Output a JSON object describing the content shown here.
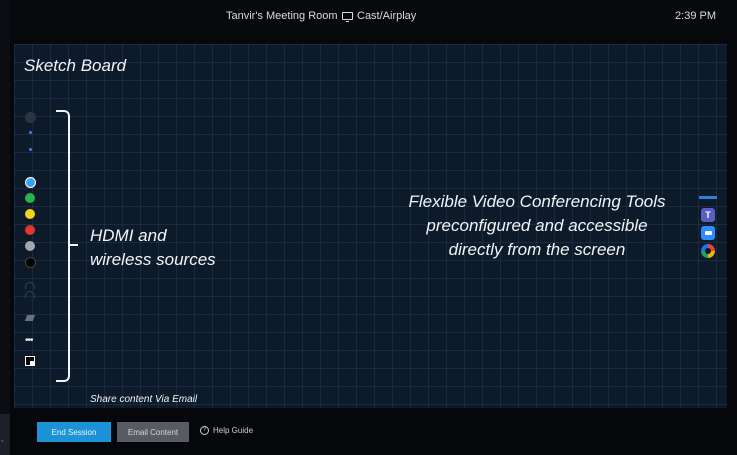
{
  "topbar": {
    "room_title": "Tanvir's Meeting Room",
    "cast_label": "Cast/Airplay",
    "time": "2:39 PM"
  },
  "board": {
    "title": "Sketch Board"
  },
  "annotations": {
    "hdmi_line1": "HDMI and",
    "hdmi_line2": "wireless sources",
    "flex_line1": "Flexible Video Conferencing Tools",
    "flex_line2": "preconfigured and accessible",
    "flex_line3": "directly from the screen",
    "share_note": "Share content Via Email"
  },
  "tools": {
    "colors": [
      "#38a3f0",
      "#27b34a",
      "#f0d31a",
      "#e1352e",
      "#a3a6ab",
      "#000000"
    ],
    "more_label": "•••"
  },
  "apps": [
    "teams-icon",
    "zoom-icon",
    "webex-icon"
  ],
  "bottom": {
    "end_session": "End Session",
    "email_content": "Email Content",
    "help_label": "Help Guide",
    "help_icon": "?"
  },
  "colors": {
    "accent": "#1c93d6",
    "board_bg": "#0d1a2a",
    "grid": "#46648c"
  }
}
